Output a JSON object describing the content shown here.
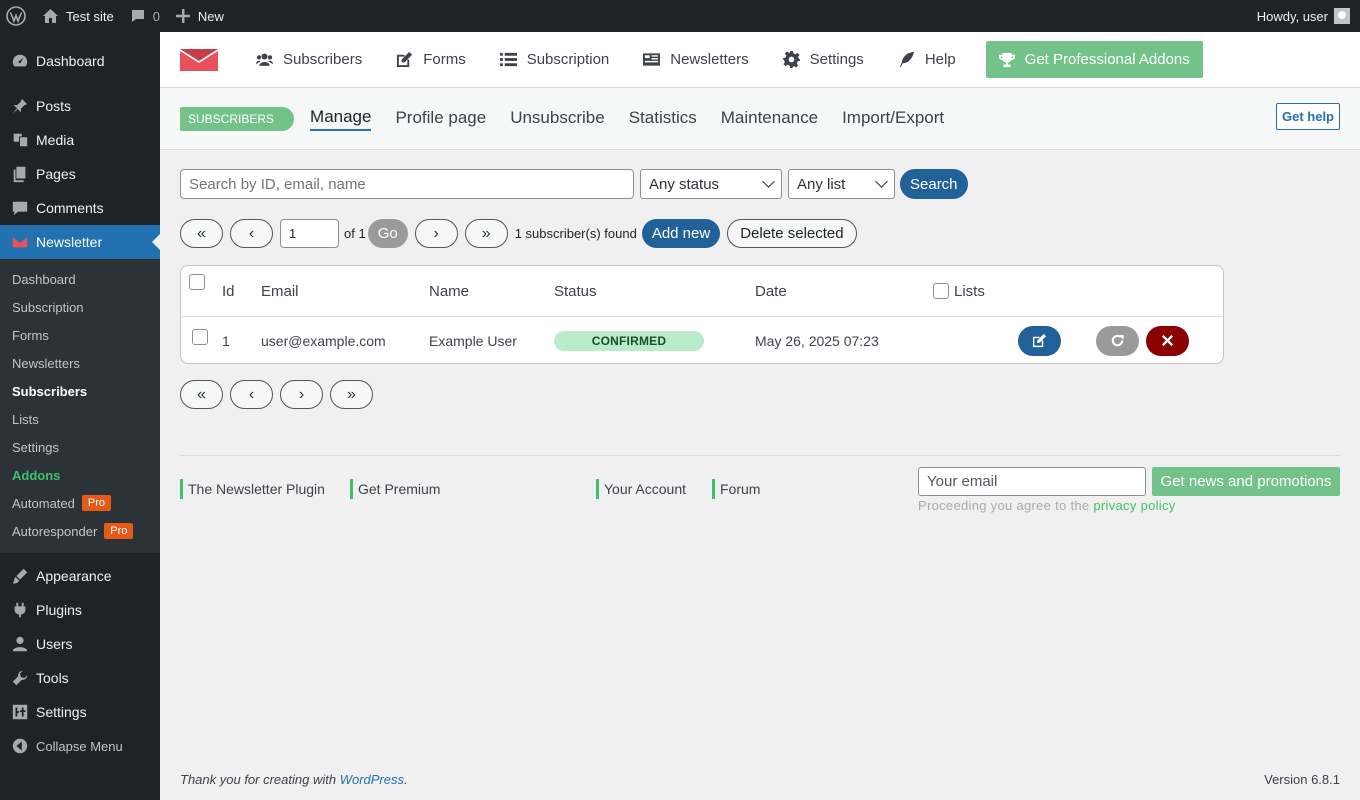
{
  "adminbar": {
    "site_name": "Test site",
    "comments_count": "0",
    "new_label": "New",
    "howdy": "Howdy, user"
  },
  "sidebar": {
    "items_top": [
      {
        "label": "Dashboard",
        "icon": "dashboard-icon"
      },
      {
        "label": "Posts",
        "icon": "pin-icon"
      },
      {
        "label": "Media",
        "icon": "media-icon"
      },
      {
        "label": "Pages",
        "icon": "pages-icon"
      },
      {
        "label": "Comments",
        "icon": "comment-icon"
      },
      {
        "label": "Newsletter",
        "icon": "newsletter-icon"
      }
    ],
    "submenu": [
      {
        "label": "Dashboard"
      },
      {
        "label": "Subscription"
      },
      {
        "label": "Forms"
      },
      {
        "label": "Newsletters"
      },
      {
        "label": "Subscribers"
      },
      {
        "label": "Lists"
      },
      {
        "label": "Settings"
      },
      {
        "label": "Addons"
      },
      {
        "label": "Automated",
        "badge": "Pro"
      },
      {
        "label": "Autoresponder",
        "badge": "Pro"
      }
    ],
    "items_bottom": [
      {
        "label": "Appearance",
        "icon": "brush-icon"
      },
      {
        "label": "Plugins",
        "icon": "plugin-icon"
      },
      {
        "label": "Users",
        "icon": "users-icon"
      },
      {
        "label": "Tools",
        "icon": "wrench-icon"
      },
      {
        "label": "Settings",
        "icon": "settings-icon"
      }
    ],
    "collapse": "Collapse Menu"
  },
  "topnav": {
    "items": [
      {
        "label": "Subscribers",
        "icon": "users-icon"
      },
      {
        "label": "Forms",
        "icon": "edit-icon"
      },
      {
        "label": "Subscription",
        "icon": "list-icon"
      },
      {
        "label": "Newsletters",
        "icon": "newspaper-icon"
      },
      {
        "label": "Settings",
        "icon": "cog-icon"
      },
      {
        "label": "Help",
        "icon": "feather-icon"
      }
    ],
    "pro_button": "Get Professional Addons"
  },
  "subheader": {
    "badge": "SUBSCRIBERS",
    "tabs": [
      "Manage",
      "Profile page",
      "Unsubscribe",
      "Statistics",
      "Maintenance",
      "Import/Export"
    ],
    "help": "Get help"
  },
  "search": {
    "placeholder": "Search by ID, email, name",
    "status_value": "Any status",
    "list_value": "Any list",
    "button": "Search"
  },
  "pager": {
    "first": "«",
    "prev": "‹",
    "next": "›",
    "last": "»",
    "page_value": "1",
    "of_text": "of 1",
    "go": "Go",
    "found_text": "1 subscriber(s) found",
    "add_new": "Add new",
    "delete_selected": "Delete selected"
  },
  "table": {
    "headers": {
      "id": "Id",
      "email": "Email",
      "name": "Name",
      "status": "Status",
      "date": "Date",
      "lists": "Lists"
    },
    "rows": [
      {
        "id": "1",
        "email": "user@example.com",
        "name": "Example User",
        "status": "CONFIRMED",
        "date": "May 26, 2025 07:23"
      }
    ]
  },
  "footer": {
    "links": [
      "The Newsletter Plugin",
      "Get Premium",
      "Your Account",
      "Forum"
    ],
    "email_placeholder": "Your email",
    "promo_button": "Get news and promotions",
    "privacy_prefix": "Proceeding you agree to the",
    "privacy_link": "privacy policy"
  },
  "wp_footer": {
    "thanks_prefix": "Thank you for creating with",
    "wp_link": "WordPress",
    "thanks_suffix": ".",
    "version": "Version 6.8.1"
  },
  "colors": {
    "wp_dark": "#1d2327",
    "wp_blue": "#2271b1",
    "tnp_green": "#72c28a",
    "addons_green": "#3ec06b",
    "pro_orange": "#e45a16",
    "delete_red": "#8b0000",
    "edit_blue": "#22609a"
  }
}
